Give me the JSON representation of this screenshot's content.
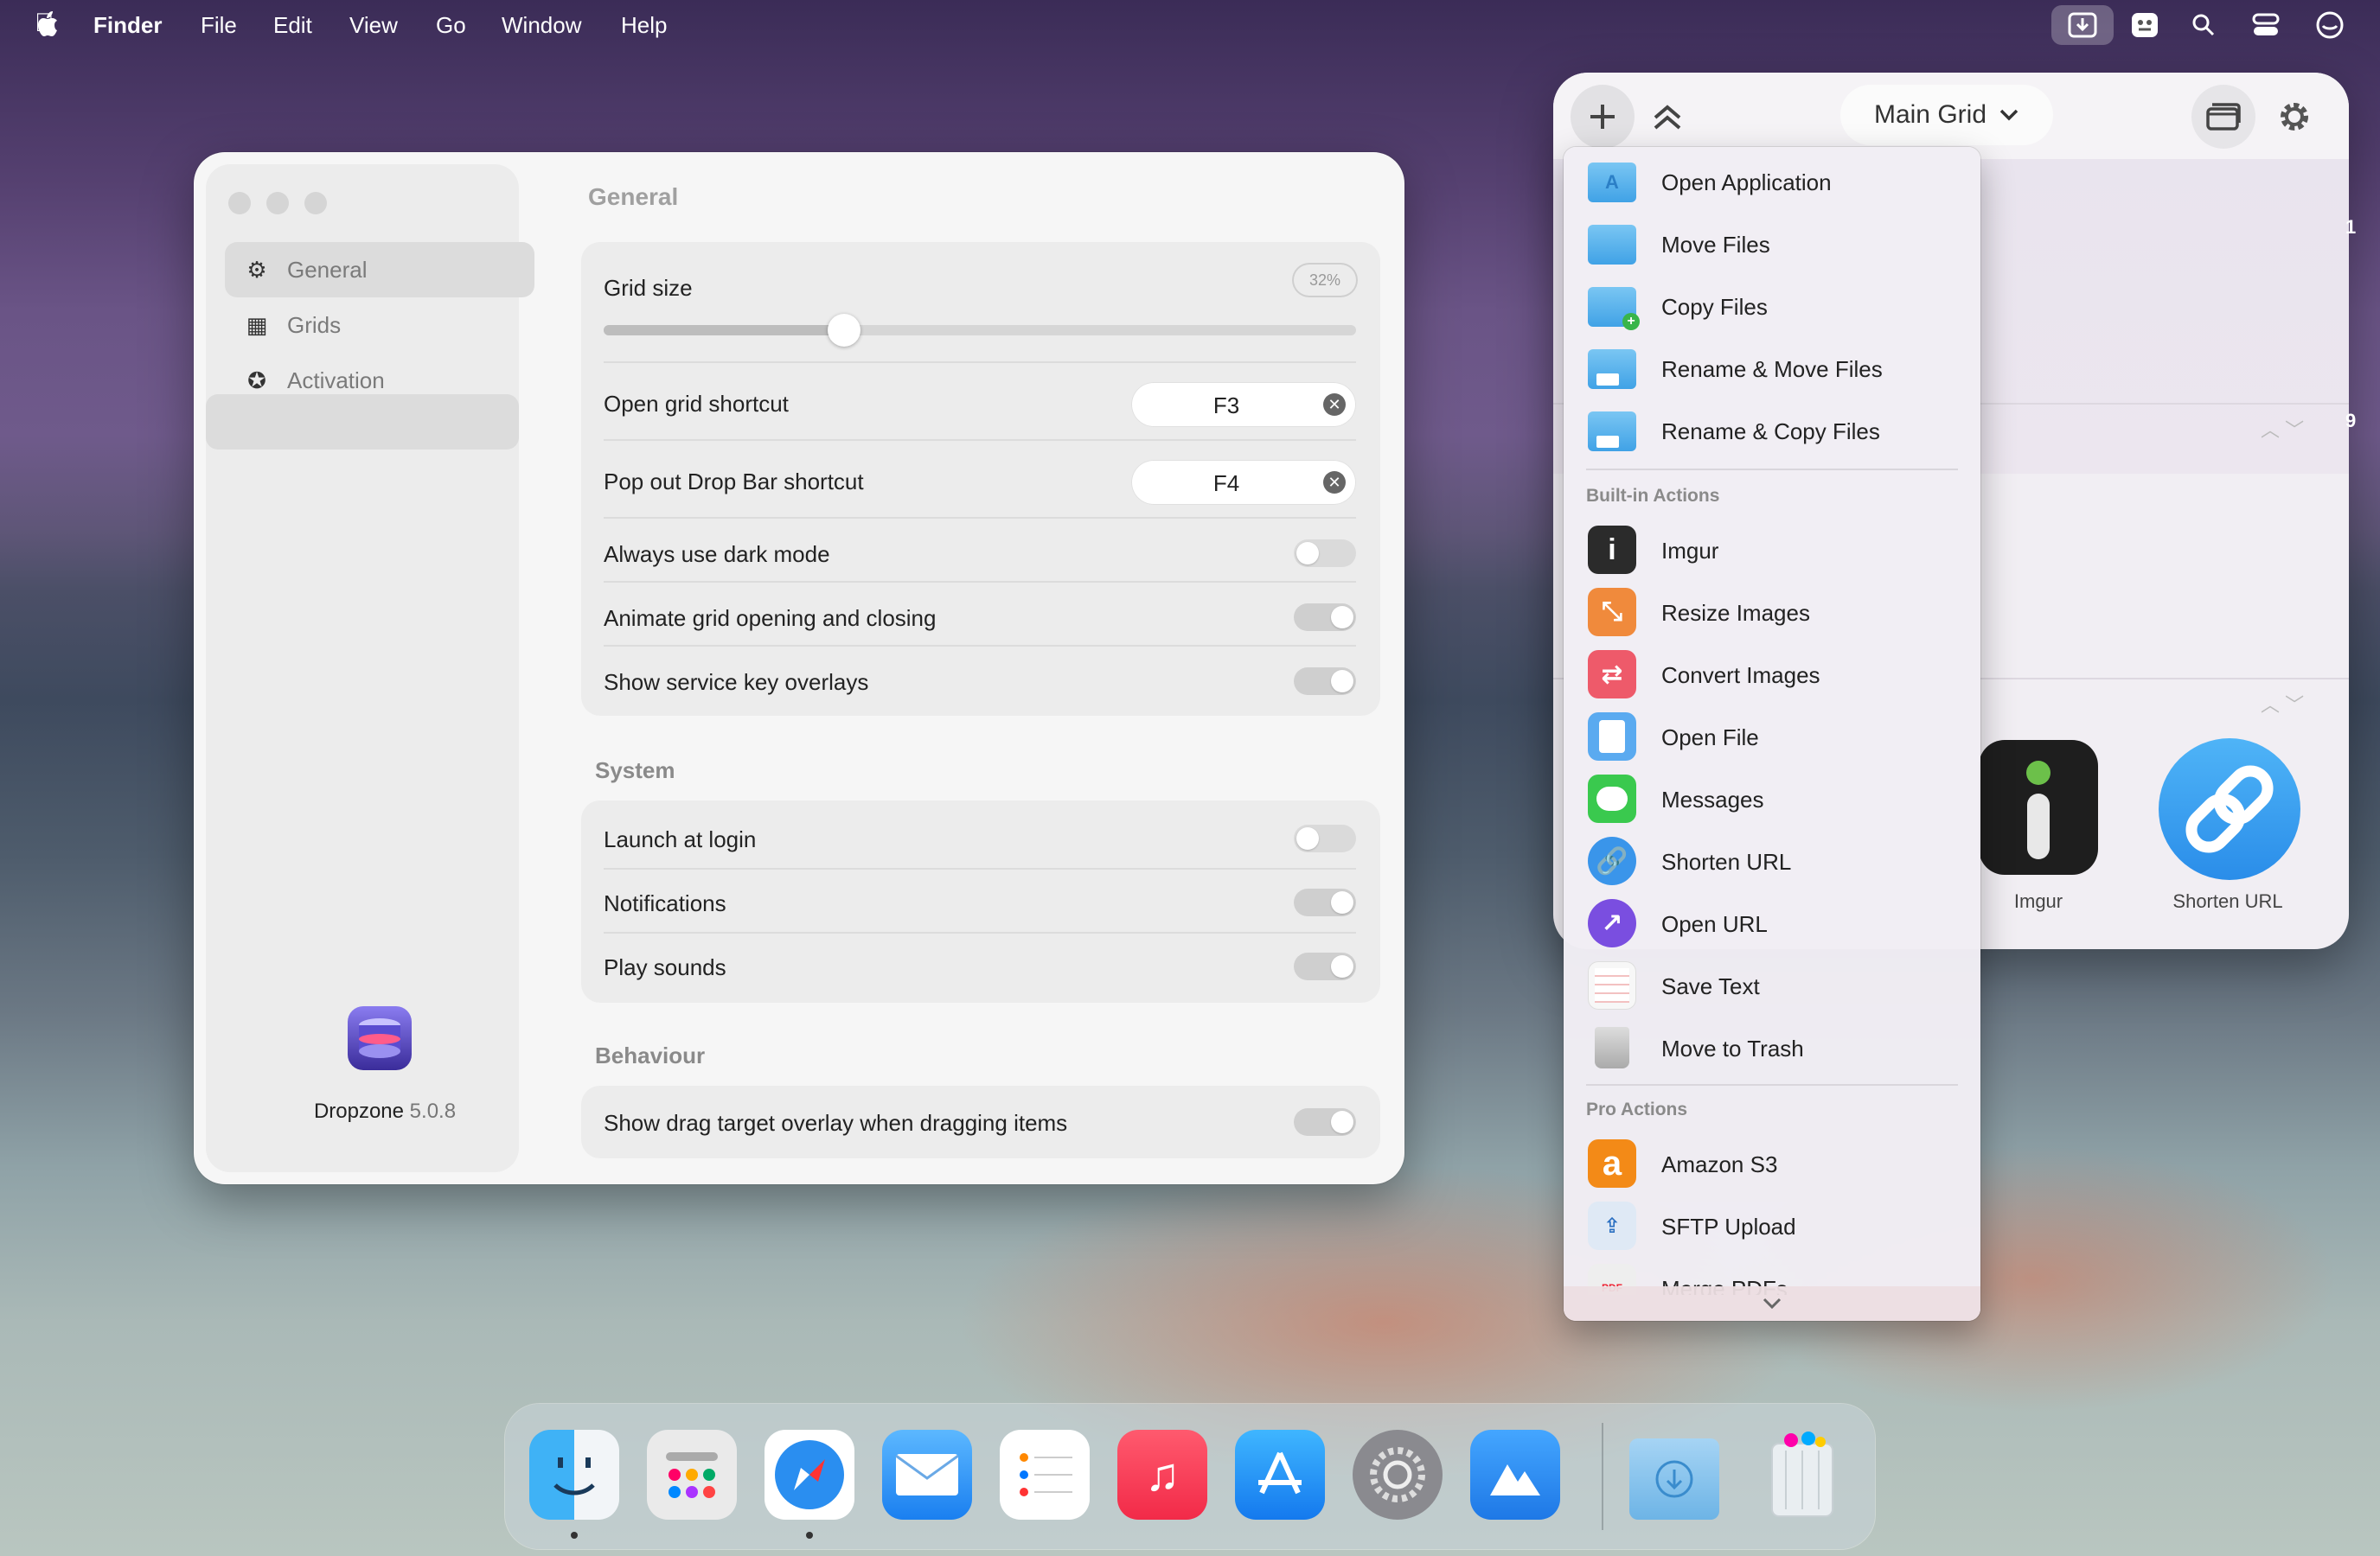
{
  "menubar": {
    "apple": "",
    "app": "Finder",
    "menus": [
      "File",
      "Edit",
      "View",
      "Go",
      "Window",
      "Help"
    ]
  },
  "settings": {
    "sidebar": {
      "items": [
        {
          "label": "General",
          "icon": "gear-icon",
          "glyph": "⚙"
        },
        {
          "label": "Grids",
          "icon": "grid-icon",
          "glyph": "▦"
        },
        {
          "label": "Activation",
          "icon": "star-circle-icon",
          "glyph": "✪"
        }
      ],
      "app_name": "Dropzone",
      "version": "5.0.8"
    },
    "general": {
      "title": "General",
      "grid_size_label": "Grid size",
      "grid_size_value": "32%",
      "grid_size_fraction": 0.32,
      "open_grid_label": "Open grid shortcut",
      "open_grid_key": "F3",
      "popout_label": "Pop out Drop Bar shortcut",
      "popout_key": "F4",
      "dark_mode_label": "Always use dark mode",
      "animate_label": "Animate grid opening and closing",
      "service_key_label": "Show service key overlays"
    },
    "system": {
      "title": "System",
      "launch_label": "Launch at login",
      "notifications_label": "Notifications",
      "sounds_label": "Play sounds"
    },
    "behaviour": {
      "title": "Behaviour",
      "drag_overlay_label": "Show drag target overlay when dragging items"
    }
  },
  "grid": {
    "title": "Main Grid",
    "tiles": [
      {
        "label": "Imgur"
      },
      {
        "label": "Shorten URL"
      }
    ],
    "edge_numbers": [
      "1",
      "9"
    ]
  },
  "dropdown": {
    "items": [
      {
        "label": "Open Application",
        "icon": "folder-app-icon"
      },
      {
        "label": "Move Files",
        "icon": "folder-icon"
      },
      {
        "label": "Copy Files",
        "icon": "folder-plus-icon"
      },
      {
        "label": "Rename & Move Files",
        "icon": "folder-rename-icon"
      },
      {
        "label": "Rename & Copy Files",
        "icon": "folder-rename-icon"
      }
    ],
    "builtin_header": "Built-in Actions",
    "builtin": [
      {
        "label": "Imgur",
        "icon": "imgur-icon",
        "color": "#2b2b2b"
      },
      {
        "label": "Resize Images",
        "icon": "resize-icon",
        "color": "#f08a3c"
      },
      {
        "label": "Convert Images",
        "icon": "convert-icon",
        "color": "#ee5a6a"
      },
      {
        "label": "Open File",
        "icon": "document-icon",
        "color": "#5aaaf0"
      },
      {
        "label": "Messages",
        "icon": "messages-icon",
        "color": "#3ac94e"
      },
      {
        "label": "Shorten URL",
        "icon": "link-icon",
        "color": "#3a95ea"
      },
      {
        "label": "Open URL",
        "icon": "external-link-icon",
        "color": "#7a4ee0"
      },
      {
        "label": "Save Text",
        "icon": "notepad-icon",
        "color": "#f4f4f4"
      },
      {
        "label": "Move to Trash",
        "icon": "trash-icon",
        "color": "#c9c9c9"
      }
    ],
    "pro_header": "Pro Actions",
    "pro": [
      {
        "label": "Amazon S3",
        "icon": "amazon-icon",
        "color": "#f38a17"
      },
      {
        "label": "SFTP Upload",
        "icon": "sftp-icon",
        "color": "#4b8fd8"
      },
      {
        "label": "Merge PDFs",
        "icon": "pdf-icon",
        "color": "#e0e0e0"
      }
    ]
  },
  "dock": {
    "apps": [
      "Finder",
      "Launchpad",
      "Safari",
      "Mail",
      "Reminders",
      "Music",
      "App Store",
      "System Settings",
      "Dropzone",
      "Downloads",
      "Trash"
    ]
  },
  "colors": {
    "accent": "#3a95ea",
    "window_bg": "#f6f6f6"
  }
}
